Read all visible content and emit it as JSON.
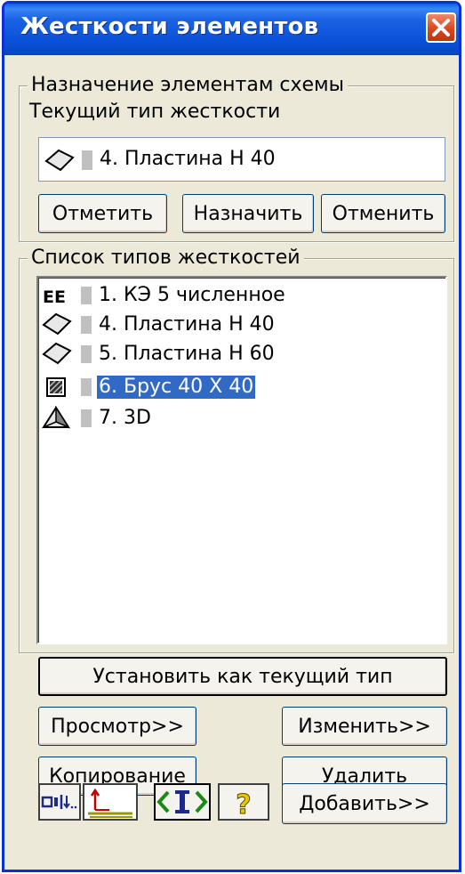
{
  "window": {
    "title": "Жесткости элементов"
  },
  "assign_group": {
    "legend": "Назначение элементам схемы",
    "current_label": "Текущий тип жесткости",
    "current_value": "4. Пластина  Н 40",
    "buttons": {
      "mark": "Отметить",
      "assign": "Назначить",
      "cancel": "Отменить"
    }
  },
  "list_group": {
    "legend": "Список типов жесткостей",
    "items": [
      {
        "label": "1. КЭ 5 численное",
        "icon": "fe-numeric-icon",
        "selected": false
      },
      {
        "label": "4. Пластина  Н 40",
        "icon": "plate-icon",
        "selected": false
      },
      {
        "label": "5. Пластина  Н 60",
        "icon": "plate-icon",
        "selected": false
      },
      {
        "label": "6. Брус 40 X 40",
        "icon": "beam-section-icon",
        "selected": true
      },
      {
        "label": "7. 3D",
        "icon": "solid-3d-icon",
        "selected": false
      }
    ]
  },
  "buttons": {
    "set_current": "Установить как текущий тип",
    "view": "Просмотр>>",
    "edit": "Изменить>>",
    "copy": "Копирование",
    "delete": "Удалить",
    "add": "Добавить>>"
  },
  "toolbar": {
    "icons": [
      "sort-list-icon",
      "axis-icon",
      "swap-icon",
      "help-icon"
    ],
    "help_glyph": "?"
  },
  "colors": {
    "title_bar": "#0a52d9",
    "selection": "#316ac5",
    "window_bg": "#ece9d8"
  }
}
